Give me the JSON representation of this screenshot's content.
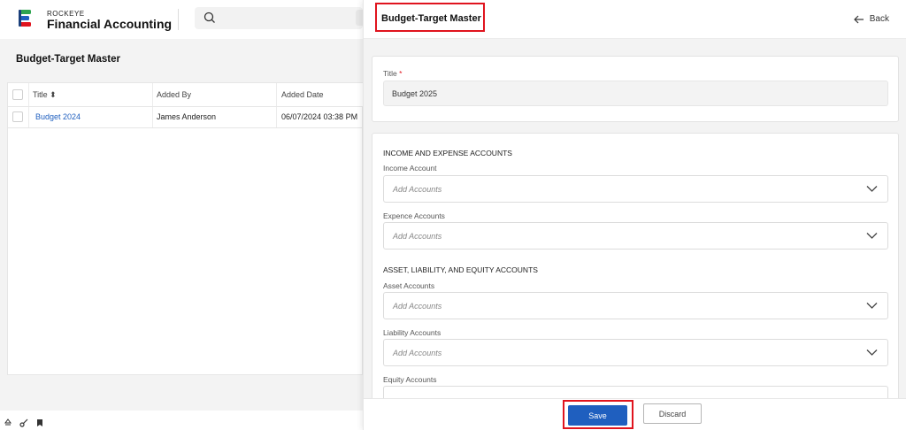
{
  "header": {
    "brand_small": "ROCKEYE",
    "brand_title": "Financial Accounting"
  },
  "background_page": {
    "title": "Budget-Target Master",
    "table": {
      "columns": [
        "Title ⬍",
        "Added By",
        "Added Date"
      ],
      "rows": [
        {
          "title": "Budget 2024",
          "added_by": "James Anderson",
          "added_date": "06/07/2024 03:38 PM"
        }
      ]
    }
  },
  "drawer": {
    "title": "Budget-Target Master",
    "back_label": "Back",
    "title_field": {
      "label": "Title",
      "required_mark": "*",
      "value": "Budget 2025"
    },
    "section_income": "INCOME AND EXPENSE ACCOUNTS",
    "section_balance": "ASSET, LIABILITY, AND EQUITY ACCOUNTS",
    "fields": [
      {
        "label": "Income Account",
        "placeholder": "Add Accounts"
      },
      {
        "label": "Expence Accounts",
        "placeholder": "Add Accounts"
      },
      {
        "label": "Asset Accounts",
        "placeholder": "Add Accounts"
      },
      {
        "label": "Liability Accounts",
        "placeholder": "Add Accounts"
      },
      {
        "label": "Equity Accounts",
        "placeholder": ""
      }
    ],
    "save_label": "Save",
    "discard_label": "Discard"
  },
  "colors": {
    "primary": "#1f5fbf",
    "highlight": "#e0141e",
    "panel_bg": "#f3f3f3"
  },
  "icons": [
    "logo-icon",
    "search-icon",
    "back-arrow-icon",
    "chevron-down-icon",
    "recycle-icon",
    "key-icon",
    "bookmark-icon"
  ]
}
